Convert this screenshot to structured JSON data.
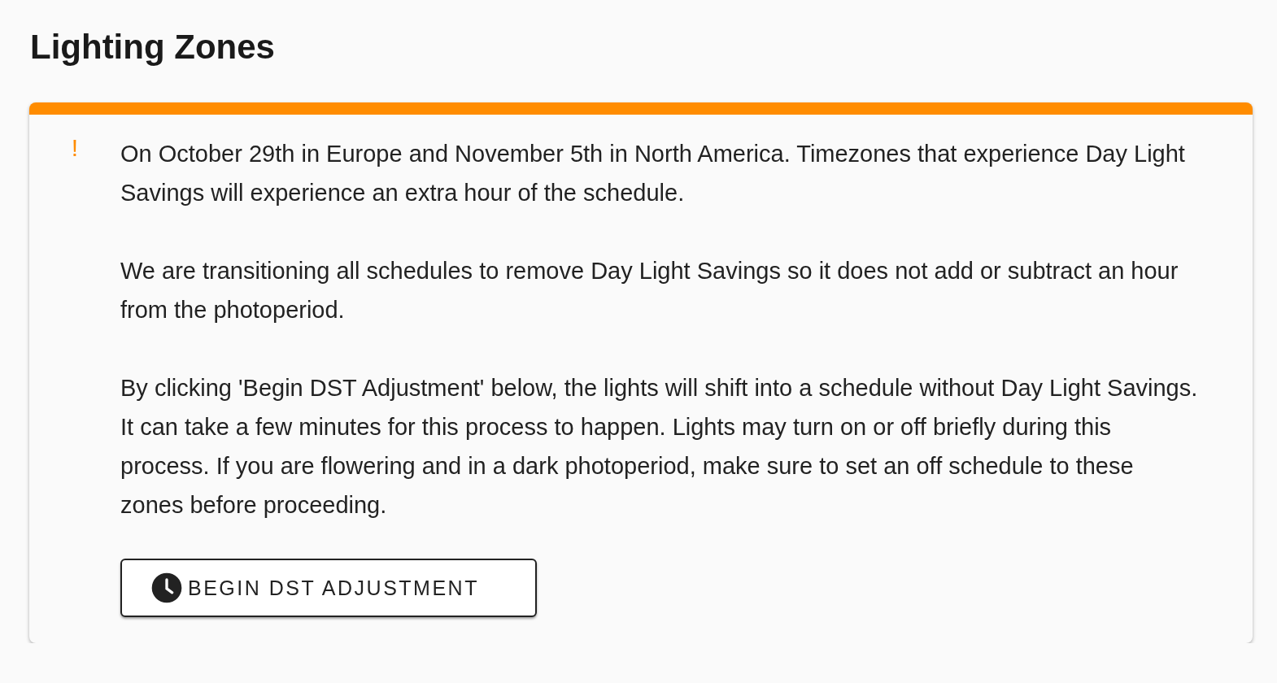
{
  "title": "Lighting Zones",
  "alert": {
    "icon_text": "!",
    "paragraphs": [
      "On October 29th in Europe and November 5th in North America. Timezones that experience Day Light Savings will experience an extra hour of the schedule.",
      "We are transitioning all schedules to remove Day Light Savings so it does not add or subtract an hour from the photoperiod.",
      "By clicking 'Begin DST Adjustment' below, the lights will shift into a schedule without Day Light Savings. It can take a few minutes for this process to happen. Lights may turn on or off briefly during this process. If you are flowering and in a dark photoperiod, make sure to set an off schedule to these zones before proceeding."
    ],
    "button": {
      "label": "BEGIN DST ADJUSTMENT"
    }
  }
}
